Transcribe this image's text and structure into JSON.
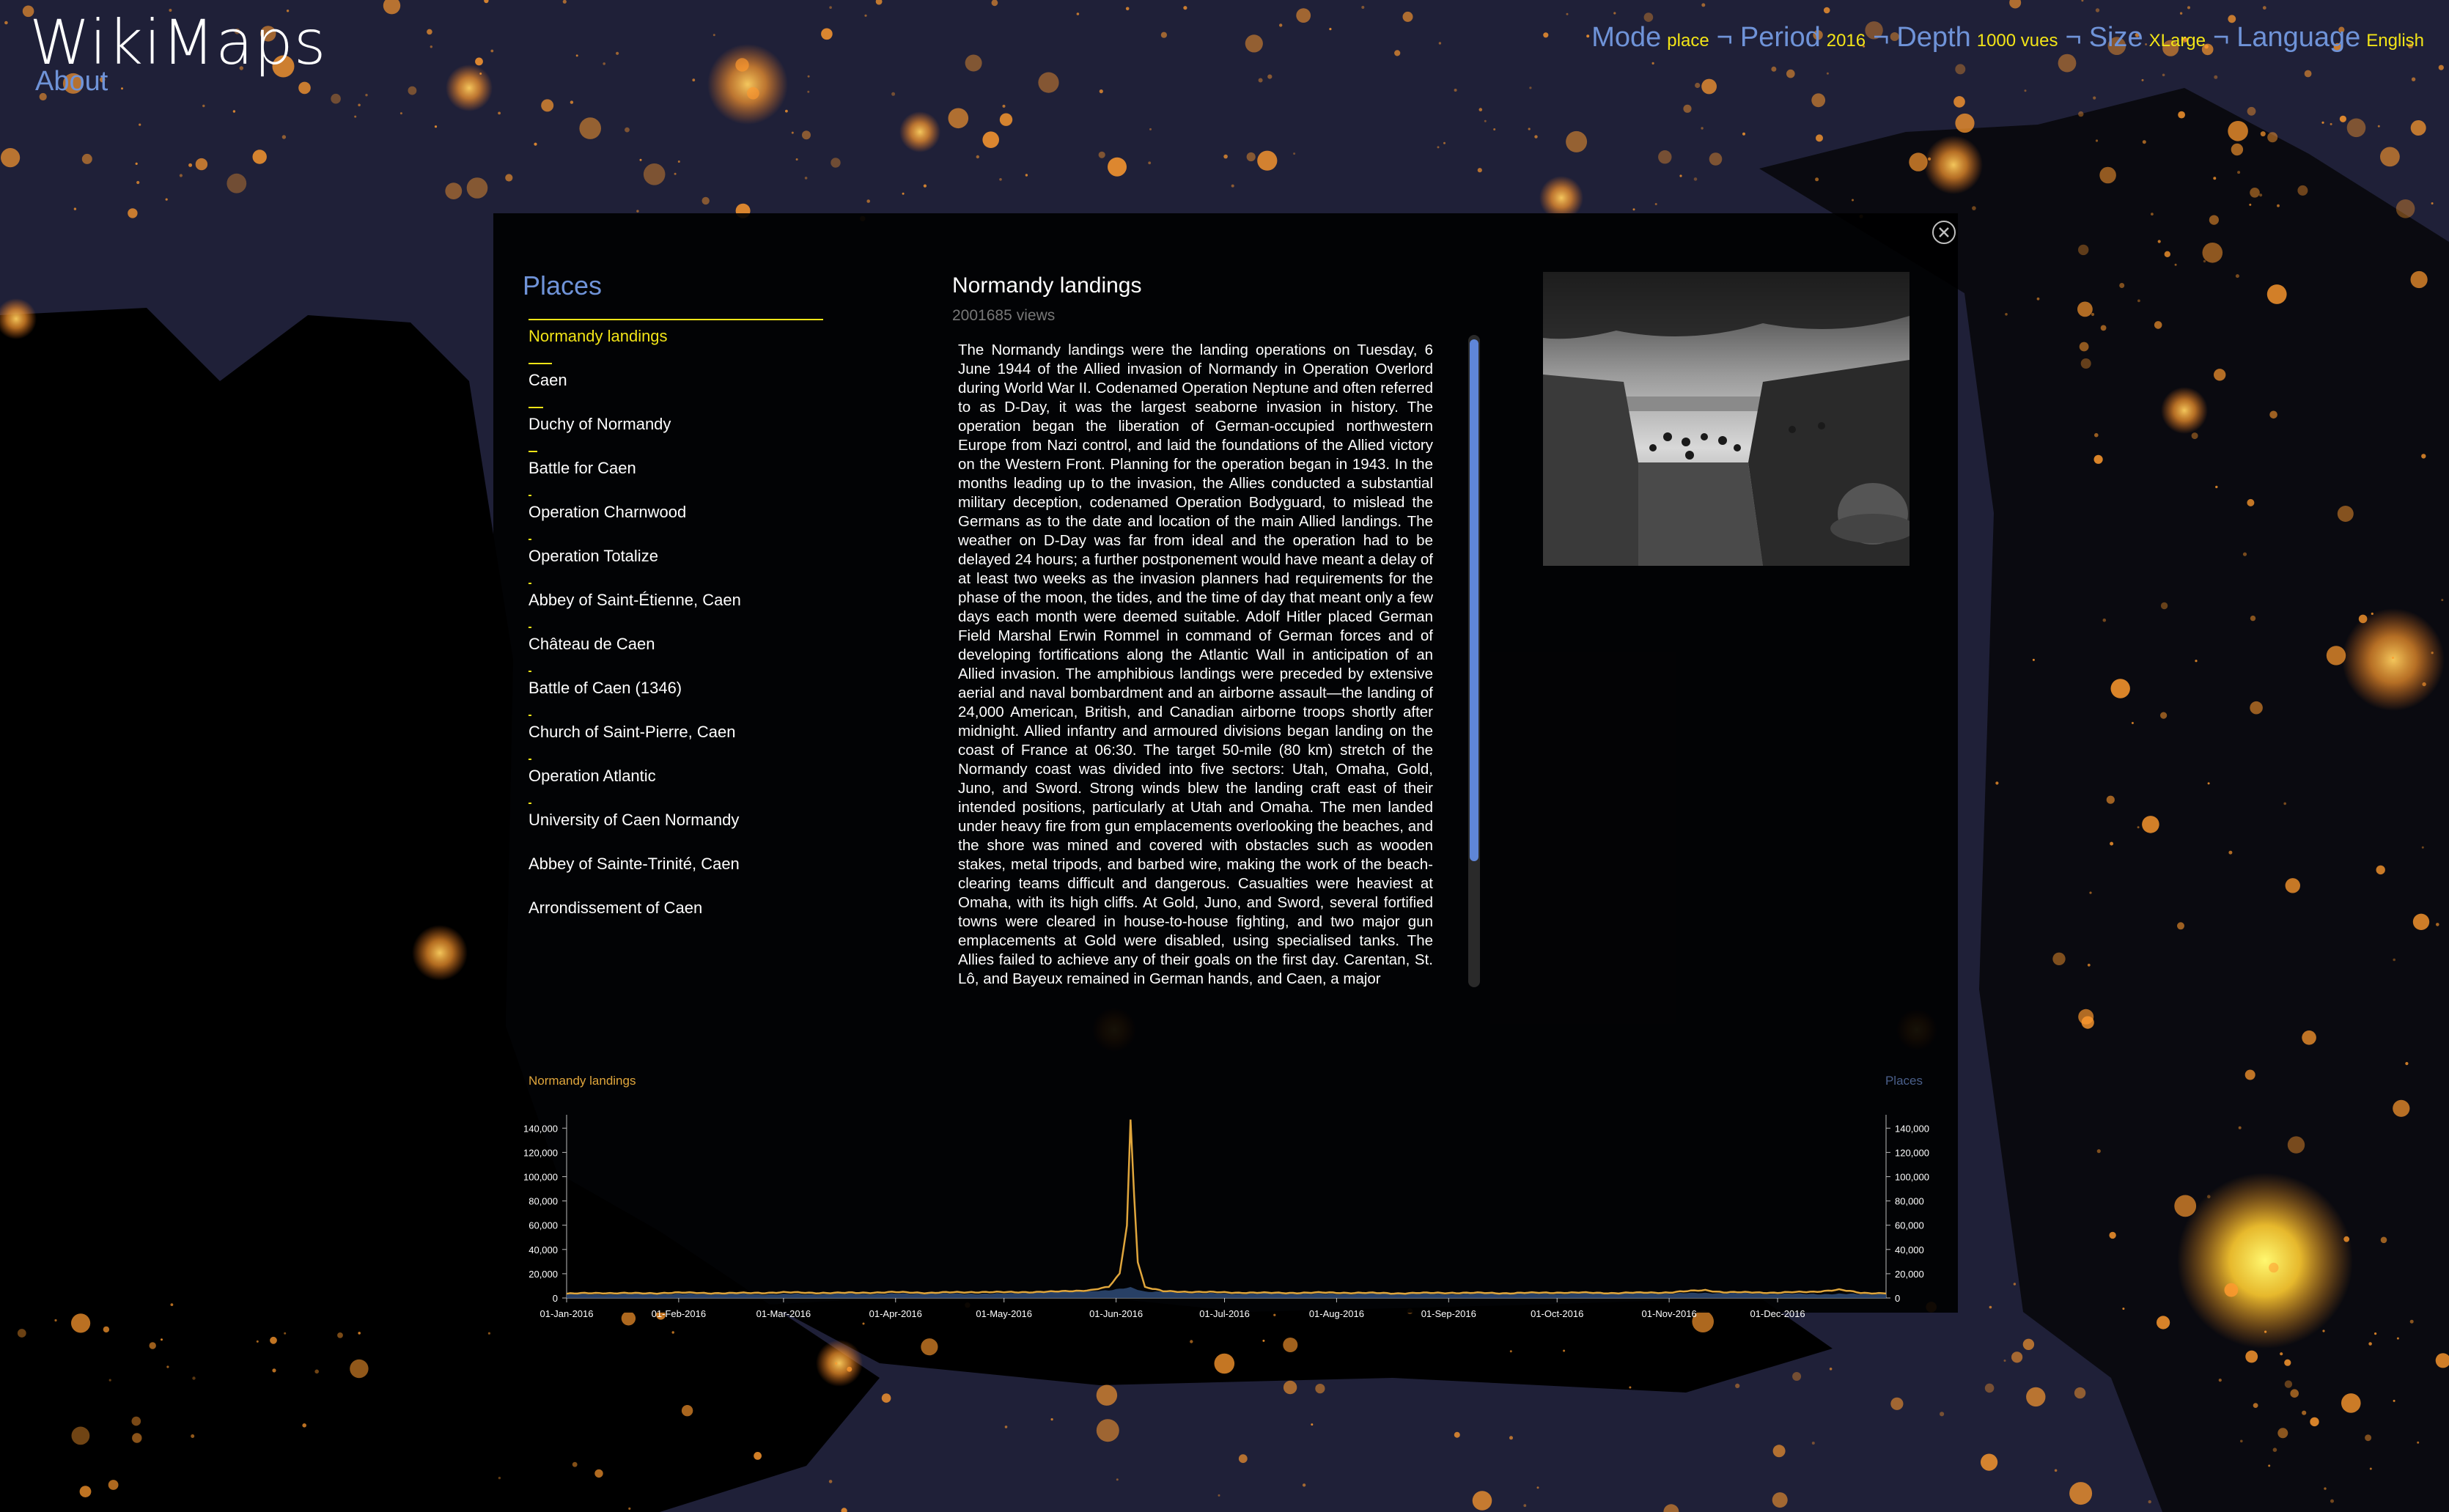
{
  "app": {
    "title": "WikiMaps",
    "about_label": "About"
  },
  "topnav": {
    "mode_label": "Mode",
    "mode_value": "place",
    "period_label": "Period",
    "period_value": "2016",
    "depth_label": "Depth",
    "depth_value": "1000 vues",
    "size_label": "Size",
    "size_value": "XLarge",
    "language_label": "Language",
    "language_value": "English",
    "separator": "¬"
  },
  "colors": {
    "accent": "#f2e417",
    "link": "#6f93d8",
    "chart_line": "#e0a63c",
    "chart_fill": "#2c4770",
    "background": "#1f2038",
    "glow": "#ff9a2e"
  },
  "icons": {
    "close": "close-circle-icon"
  },
  "places": {
    "heading": "Places",
    "selected_index": 0,
    "items": [
      {
        "label": "Normandy landings",
        "weight": 1.0
      },
      {
        "label": "Caen",
        "weight": 0.08
      },
      {
        "label": "Duchy of Normandy",
        "weight": 0.05
      },
      {
        "label": "Battle for Caen",
        "weight": 0.03
      },
      {
        "label": "Operation Charnwood",
        "weight": 0.01
      },
      {
        "label": "Operation Totalize",
        "weight": 0.01
      },
      {
        "label": "Abbey of Saint-Étienne, Caen",
        "weight": 0.01
      },
      {
        "label": "Château de Caen",
        "weight": 0.01
      },
      {
        "label": "Battle of Caen (1346)",
        "weight": 0.01
      },
      {
        "label": "Church of Saint-Pierre, Caen",
        "weight": 0.01
      },
      {
        "label": "Operation Atlantic",
        "weight": 0.01
      },
      {
        "label": "University of Caen Normandy",
        "weight": 0.01
      },
      {
        "label": "Abbey of Sainte-Trinité, Caen",
        "weight": 0
      },
      {
        "label": "Arrondissement of Caen",
        "weight": 0
      }
    ]
  },
  "article": {
    "title": "Normandy landings",
    "views_count": "2001685",
    "views_unit": "views",
    "text": "The Normandy landings were the landing operations on Tuesday, 6 June 1944 of the Allied invasion of Normandy in Operation Overlord during World War II. Codenamed Operation Neptune and often referred to as D-Day, it was the largest seaborne invasion in history. The operation began the liberation of German-occupied northwestern Europe from Nazi control, and laid the foundations of the Allied victory on the Western Front. Planning for the operation began in 1943. In the months leading up to the invasion, the Allies conducted a substantial military deception, codenamed Operation Bodyguard, to mislead the Germans as to the date and location of the main Allied landings. The weather on D-Day was far from ideal and the operation had to be delayed 24 hours; a further postponement would have meant a delay of at least two weeks as the invasion planners had requirements for the phase of the moon, the tides, and the time of day that meant only a few days each month were deemed suitable. Adolf Hitler placed German Field Marshal Erwin Rommel in command of German forces and of developing fortifications along the Atlantic Wall in anticipation of an Allied invasion. The amphibious landings were preceded by extensive aerial and naval bombardment and an airborne assault—the landing of 24,000 American, British, and Canadian airborne troops shortly after midnight. Allied infantry and armoured divisions began landing on the coast of France at 06:30. The target 50-mile (80 km) stretch of the Normandy coast was divided into five sectors: Utah, Omaha, Gold, Juno, and Sword. Strong winds blew the landing craft east of their intended positions, particularly at Utah and Omaha. The men landed under heavy fire from gun emplacements overlooking the beaches, and the shore was mined and covered with obstacles such as wooden stakes, metal tripods, and barbed wire, making the work of the beach-clearing teams difficult and dangerous. Casualties were heaviest at Omaha, with its high cliffs. At Gold, Juno, and Sword, several fortified towns were cleared in house-to-house fighting, and two major gun emplacements at Gold were disabled, using specialised tanks. The Allies failed to achieve any of their goals on the first day. Carentan, St. Lô, and Bayeux remained in German hands, and Caen, a major",
    "scroll_fraction": 0.0
  },
  "chart_data": {
    "type": "area",
    "left_label": "Normandy landings",
    "right_label": "Places",
    "x_ticks": [
      "01-Jan-2016",
      "01-Feb-2016",
      "01-Mar-2016",
      "01-Apr-2016",
      "01-May-2016",
      "01-Jun-2016",
      "01-Jul-2016",
      "01-Aug-2016",
      "01-Sep-2016",
      "01-Oct-2016",
      "01-Nov-2016",
      "01-Dec-2016"
    ],
    "x_tick_days": [
      0,
      31,
      60,
      91,
      121,
      152,
      182,
      213,
      244,
      274,
      305,
      335
    ],
    "x_domain_days": [
      0,
      365
    ],
    "y_ticks": [
      "0",
      "20,000",
      "40,000",
      "60,000",
      "80,000",
      "100,000",
      "120,000",
      "140,000"
    ],
    "ylim": [
      0,
      145000
    ],
    "series": [
      {
        "values_sparse": [
          [
            0,
            3500
          ],
          [
            10,
            4200
          ],
          [
            20,
            3800
          ],
          [
            31,
            4400
          ],
          [
            45,
            3900
          ],
          [
            60,
            4600
          ],
          [
            75,
            4100
          ],
          [
            91,
            4800
          ],
          [
            100,
            4300
          ],
          [
            115,
            5000
          ],
          [
            121,
            4700
          ],
          [
            135,
            5200
          ],
          [
            145,
            6500
          ],
          [
            150,
            9000
          ],
          [
            153,
            20000
          ],
          [
            155,
            60000
          ],
          [
            156,
            147000
          ],
          [
            157,
            85000
          ],
          [
            158,
            30000
          ],
          [
            160,
            9000
          ],
          [
            165,
            5500
          ],
          [
            175,
            5000
          ],
          [
            182,
            4600
          ],
          [
            195,
            4200
          ],
          [
            213,
            4400
          ],
          [
            230,
            3900
          ],
          [
            244,
            4300
          ],
          [
            260,
            4000
          ],
          [
            274,
            4500
          ],
          [
            290,
            4100
          ],
          [
            305,
            4600
          ],
          [
            315,
            6500
          ],
          [
            320,
            4800
          ],
          [
            335,
            4400
          ],
          [
            345,
            5200
          ],
          [
            352,
            6800
          ],
          [
            358,
            4200
          ],
          [
            365,
            4000
          ]
        ]
      },
      {
        "values_sparse": [
          [
            0,
            3000
          ],
          [
            31,
            3300
          ],
          [
            60,
            3100
          ],
          [
            91,
            3500
          ],
          [
            121,
            3600
          ],
          [
            150,
            6000
          ],
          [
            156,
            9000
          ],
          [
            160,
            5200
          ],
          [
            182,
            3500
          ],
          [
            213,
            3400
          ],
          [
            244,
            3300
          ],
          [
            274,
            3500
          ],
          [
            305,
            3700
          ],
          [
            315,
            4200
          ],
          [
            335,
            3400
          ],
          [
            365,
            3200
          ]
        ]
      }
    ]
  }
}
